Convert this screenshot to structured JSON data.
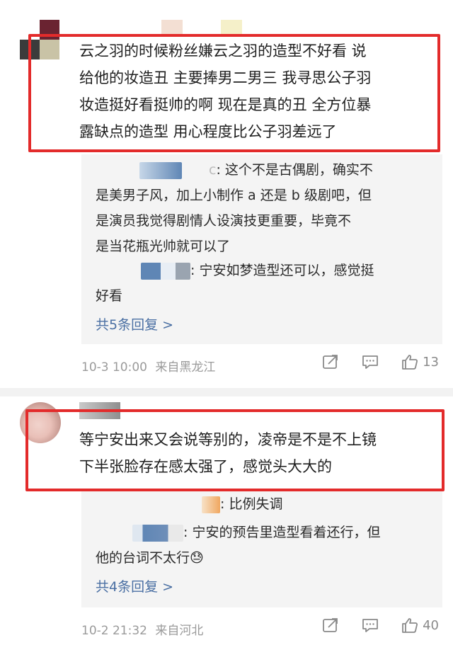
{
  "comments": [
    {
      "text_lines": [
        "云之羽的时候粉丝嫌云之羽的造型不好看 说",
        "给他的妆造丑 主要捧男二男三 我寻思公子羽",
        "妆造挺好看挺帅的啊 现在是真的丑 全方位暴",
        "露缺点的造型 用心程度比公子羽差远了"
      ],
      "replies": [
        {
          "nick_tail": "c",
          "lines": [
            ": 这个不是古偶剧，确实不",
            "是美男子风，加上小制作 a 还是 b 级剧吧，但",
            "是演员我觉得剧情人设演技更重要，毕竟不",
            "是当花瓶光帅就可以了"
          ]
        },
        {
          "nick_tail": "",
          "lines": [
            ": 宁安如梦造型还可以，感觉挺",
            "好看"
          ]
        }
      ],
      "more_replies": "共5条回复 >",
      "date": "10-3 10:00",
      "location": "来自黑龙江",
      "like_count": "13"
    },
    {
      "text_lines": [
        "等宁安出来又会说等别的，凌帝是不是不上镜",
        "下半张脸存在感太强了，感觉头大大的"
      ],
      "replies": [
        {
          "nick_tail": "",
          "lines": [
            ": 比例失调"
          ]
        },
        {
          "nick_tail": "",
          "lines": [
            ": 宁安的预告里造型看着还行，但",
            "他的台词不太行😓"
          ]
        }
      ],
      "more_replies": "共4条回复 >",
      "date": "10-2 21:32",
      "location": "来自河北",
      "like_count": "40"
    }
  ],
  "icons": {
    "share": "share-icon",
    "comment": "comment-icon",
    "like": "thumbs-up-icon"
  },
  "colors": {
    "highlight_box": "#e32b2b",
    "link": "#4a6fa3",
    "meta": "#9a9a9a",
    "reply_bg": "#f4f4f4"
  }
}
